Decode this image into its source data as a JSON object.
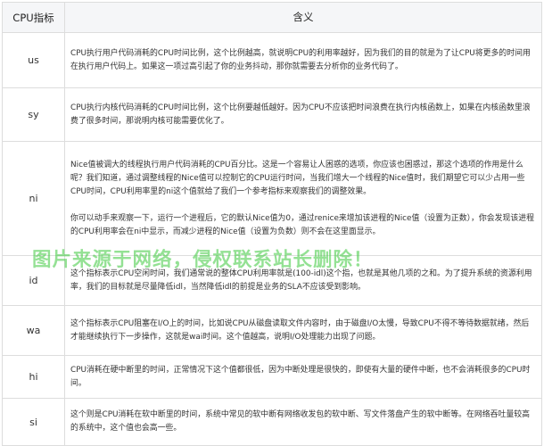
{
  "header": {
    "col1": "CPU指标",
    "col2": "含义"
  },
  "rows": [
    {
      "key": "us",
      "paras": [
        "CPU执行用户代码消耗的CPU时间比例，这个比例越高，就说明CPU的利用率越好，因为我们的目的就是为了让CPU将更多的时间用在执行用户代码上。如果这一项过高引起了你的业务抖动，那你就需要去分析你的业务代码了。"
      ]
    },
    {
      "key": "sy",
      "paras": [
        "CPU执行内核代码消耗的CPU时间比例，这个比例要越低越好。因为CPU不应该把时间浪费在执行内核函数上，如果在内核函数里浪费了很多时间，那说明内核可能需要优化了。"
      ]
    },
    {
      "key": "ni",
      "paras": [
        "Nice值被调大的线程执行用户代码消耗的CPU百分比。这是一个容易让人困惑的选项，你应该也困惑过，那这个选项的作用是什么呢？我们知道，通过调整线程的Nice值可以控制它的CPU运行时间，当我们增大一个线程的Nice值时，我们期望它可以少占用一些CPU时间，CPU利用率里的ni这个值就给了我们一个参考指标来观察我们的调整效果。",
        "你可以动手来观察一下，运行一个进程后，它的默认Nice值为0，通过renice来增加该进程的Nice值（设置为正数），你会发现该进程的CPU利用率会在ni中显示，而减少进程的Nice值（设置为负数）则不会在这里面显示。"
      ]
    },
    {
      "key": "id",
      "paras": [
        "这个指标表示CPU空闲时间，我们通常说的整体CPU利用率就是(100-idl)这个指，也就是其他几项的之和。为了提升系统的资源利用率，我们的目标就是尽量降低idl，当然降低idl的前提是业务的SLA不应该受到影响。"
      ]
    },
    {
      "key": "wa",
      "paras": [
        "这个指标表示CPU阻塞在I/O上的时间，比如说CPU从磁盘读取文件内容时，由于磁盘I/O太慢，导致CPU不得不等待数据就绪，然后才能继续执行下一步操作，这就是wai时间。这个值越高，说明I/O处理能力出现了问题。"
      ]
    },
    {
      "key": "hi",
      "paras": [
        "CPU消耗在硬中断里的时间，正常情况下这个值都很低，因为中断处理是很快的，即使有大量的硬件中断，也不会消耗很多的CPU时间。"
      ]
    },
    {
      "key": "si",
      "paras": [
        "这个则是CPU消耗在软中断里的时间，系统中常见的软中断有网络收发包的软中断、写文件落盘产生的软中断等。在网络吞吐量较高的系统中，这个值也会高一些。"
      ]
    }
  ],
  "watermark": "图片来源于网络，侵权联系站长删除！"
}
